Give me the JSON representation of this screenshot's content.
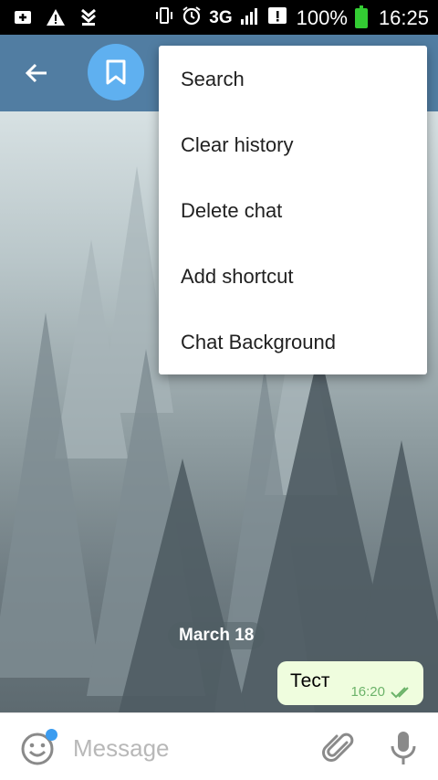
{
  "status_bar": {
    "network": "3G",
    "battery": "100%",
    "time": "16:25"
  },
  "toolbar": {
    "back_icon": "arrow-left-icon",
    "avatar_icon": "bookmark-icon",
    "color": "#517da2"
  },
  "menu": {
    "items": [
      {
        "label": "Search"
      },
      {
        "label": "Clear history"
      },
      {
        "label": "Delete chat"
      },
      {
        "label": "Add shortcut"
      },
      {
        "label": "Chat Background"
      }
    ]
  },
  "chat": {
    "date": "March 18",
    "messages": [
      {
        "text": "Тест",
        "time": "16:20",
        "status": "read"
      }
    ]
  },
  "input": {
    "placeholder": "Message"
  },
  "colors": {
    "accent": "#5fb0f0",
    "outgoing_bubble": "#effdde",
    "time_green": "#6cb36a"
  }
}
